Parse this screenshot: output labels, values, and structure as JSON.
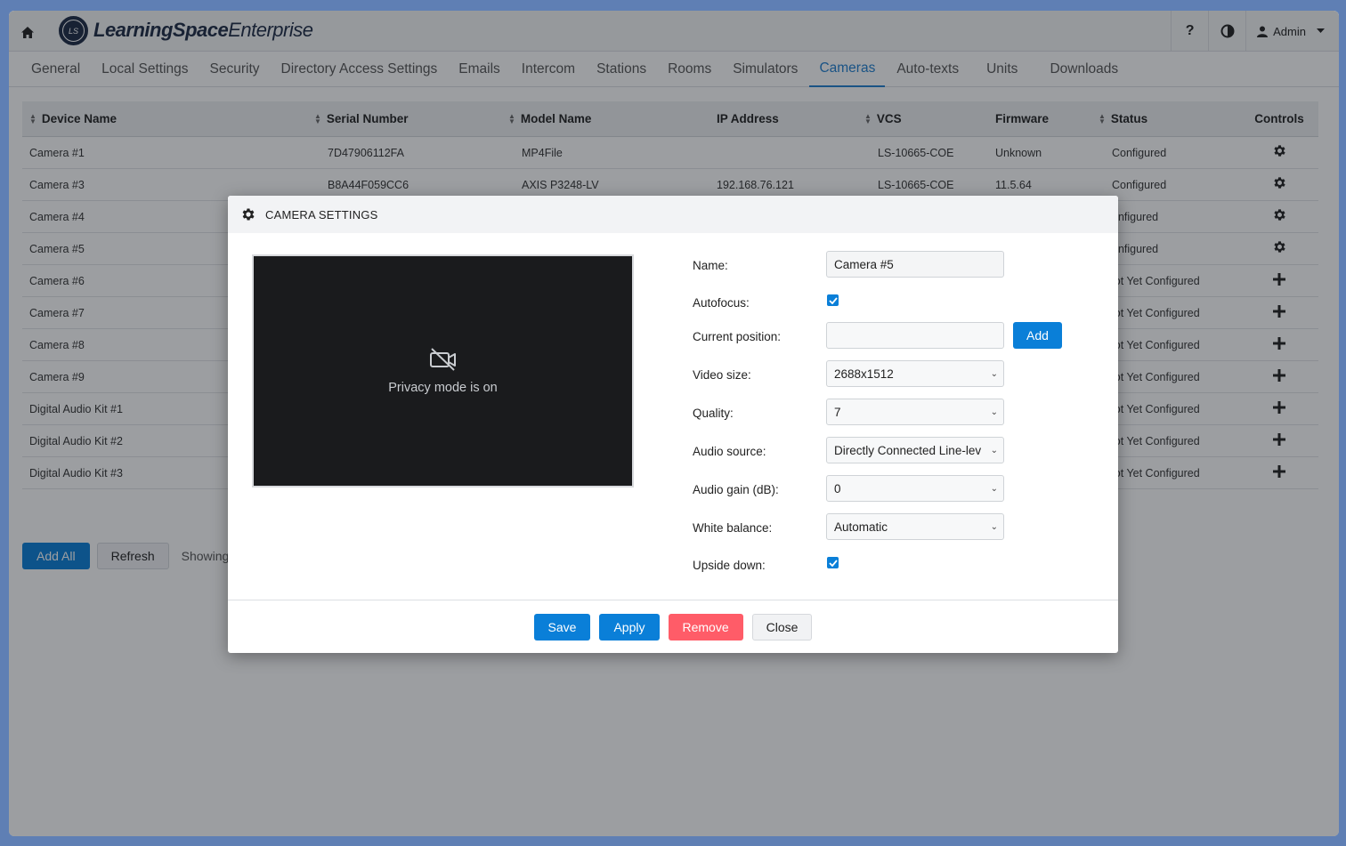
{
  "header": {
    "logo_initials": "LS",
    "brand_bold": "LearningSpace",
    "brand_light": "Enterprise",
    "help_label": "?",
    "user_label": "Admin"
  },
  "tabs": [
    {
      "label": "General"
    },
    {
      "label": "Local Settings"
    },
    {
      "label": "Security"
    },
    {
      "label": "Directory Access Settings"
    },
    {
      "label": "Emails"
    },
    {
      "label": "Intercom"
    },
    {
      "label": "Stations"
    },
    {
      "label": "Rooms"
    },
    {
      "label": "Simulators"
    },
    {
      "label": "Cameras",
      "active": true
    },
    {
      "label": "Auto-texts"
    },
    {
      "label": "Units"
    },
    {
      "label": "Downloads"
    }
  ],
  "table": {
    "columns": [
      "Device Name",
      "Serial Number",
      "Model Name",
      "IP Address",
      "VCS",
      "Firmware",
      "Status",
      "Controls"
    ],
    "rows": [
      {
        "name": "Camera #1",
        "serial": "7D47906112FA",
        "model": "MP4File",
        "ip": "",
        "vcs": "LS-10665-COE",
        "firmware": "Unknown",
        "status": "Configured",
        "control": "gear-icon"
      },
      {
        "name": "Camera #3",
        "serial": "B8A44F059CC6",
        "model": "AXIS P3248-LV",
        "ip": "192.168.76.121",
        "vcs": "LS-10665-COE",
        "firmware": "11.5.64",
        "status": "Configured",
        "control": "gear-icon"
      },
      {
        "name": "Camera #4",
        "serial": "",
        "model": "",
        "ip": "",
        "vcs": "",
        "firmware": "",
        "status": "onfigured",
        "control": "gear-icon"
      },
      {
        "name": "Camera #5",
        "serial": "",
        "model": "",
        "ip": "",
        "vcs": "",
        "firmware": "",
        "status": "onfigured",
        "control": "gear-icon"
      },
      {
        "name": "Camera #6",
        "serial": "",
        "model": "",
        "ip": "",
        "vcs": "",
        "firmware": "",
        "status": "lot Yet Configured",
        "control": "plus-icon"
      },
      {
        "name": "Camera #7",
        "serial": "",
        "model": "",
        "ip": "",
        "vcs": "",
        "firmware": "",
        "status": "lot Yet Configured",
        "control": "plus-icon"
      },
      {
        "name": "Camera #8",
        "serial": "",
        "model": "",
        "ip": "",
        "vcs": "",
        "firmware": "",
        "status": "lot Yet Configured",
        "control": "plus-icon"
      },
      {
        "name": "Camera #9",
        "serial": "",
        "model": "",
        "ip": "",
        "vcs": "",
        "firmware": "",
        "status": "lot Yet Configured",
        "control": "plus-icon"
      },
      {
        "name": "Digital Audio Kit #1",
        "serial": "",
        "model": "",
        "ip": "",
        "vcs": "",
        "firmware": "",
        "status": "lot Yet Configured",
        "control": "plus-icon"
      },
      {
        "name": "Digital Audio Kit #2",
        "serial": "",
        "model": "",
        "ip": "",
        "vcs": "",
        "firmware": "",
        "status": "lot Yet Configured",
        "control": "plus-icon"
      },
      {
        "name": "Digital Audio Kit #3",
        "serial": "",
        "model": "",
        "ip": "",
        "vcs": "",
        "firmware": "",
        "status": "lot Yet Configured",
        "control": "plus-icon"
      }
    ]
  },
  "bottom": {
    "add_all": "Add All",
    "refresh": "Refresh",
    "showing": "Showing c"
  },
  "modal": {
    "title": "CAMERA SETTINGS",
    "preview_text": "Privacy mode is on",
    "fields": {
      "name_label": "Name:",
      "name_value": "Camera #5",
      "autofocus_label": "Autofocus:",
      "autofocus_checked": true,
      "position_label": "Current position:",
      "position_value": "",
      "position_add": "Add",
      "video_size_label": "Video size:",
      "video_size_value": "2688x1512",
      "quality_label": "Quality:",
      "quality_value": "7",
      "audio_source_label": "Audio source:",
      "audio_source_value": "Directly Connected Line-lev",
      "audio_gain_label": "Audio gain (dB):",
      "audio_gain_value": "0",
      "white_balance_label": "White balance:",
      "white_balance_value": "Automatic",
      "upside_down_label": "Upside down:",
      "upside_down_checked": true
    },
    "buttons": {
      "save": "Save",
      "apply": "Apply",
      "remove": "Remove",
      "close": "Close"
    }
  },
  "colors": {
    "primary": "#0a7fd8",
    "danger": "#ff5c68",
    "tab_active": "#1f7fcf",
    "desktop": "#5f7fb4"
  }
}
